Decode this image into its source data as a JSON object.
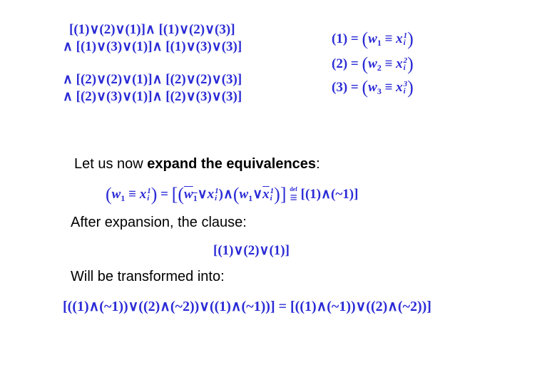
{
  "clauses_block1": {
    "line1": "[(1)∨(2)∨(1)]∧ [(1)∨(2)∨(3)]",
    "line2": "∧ [(1)∨(3)∨(1)]∧ [(1)∨(3)∨(3)]"
  },
  "clauses_block2": {
    "line1": "∧ [(2)∨(2)∨(1)]∧ [(2)∨(2)∨(3)]",
    "line2": "∧ [(2)∨(3)∨(1)]∧ [(2)∨(3)∨(3)]"
  },
  "definitions": [
    {
      "lhs": "(1) = ",
      "w": "w",
      "wsub": "1",
      "equiv": " ≡ ",
      "x": "x",
      "xsup": "1",
      "xsub": "i"
    },
    {
      "lhs": "(2) = ",
      "w": "w",
      "wsub": "2",
      "equiv": " ≡ ",
      "x": "x",
      "xsup": "2",
      "xsub": "i"
    },
    {
      "lhs": "(3) = ",
      "w": "w",
      "wsub": "3",
      "equiv": " ≡ ",
      "x": "x",
      "xsup": "3",
      "xsub": "i"
    }
  ],
  "text": {
    "expand_prefix": "Let us now ",
    "expand_bold": "expand the equivalences",
    "expand_suffix": ":",
    "after_expansion": "After expansion, the clause:",
    "will_transform": "Will be transformed into:"
  },
  "expansion": {
    "open": "(",
    "w": "w",
    "wsub": "1",
    "equiv": " ≡ ",
    "x": "x",
    "xsup": "1",
    "xsub": "i",
    "close": ")",
    "eq": " = ",
    "or": "∨",
    "and": "∧",
    "def_label": "def",
    "def_eq": "≡",
    "result": " [(1)∧(~1)]"
  },
  "example_clause": "[(1)∨(2)∨(1)]",
  "transformed": "[((1)∧(~1))∨((2)∧(~2))∨((1)∧(~1))] = [((1)∧(~1))∨((2)∧(~2))]",
  "colors": {
    "math": "#2b2bd6",
    "text": "#000000",
    "background": "#ffffff"
  }
}
